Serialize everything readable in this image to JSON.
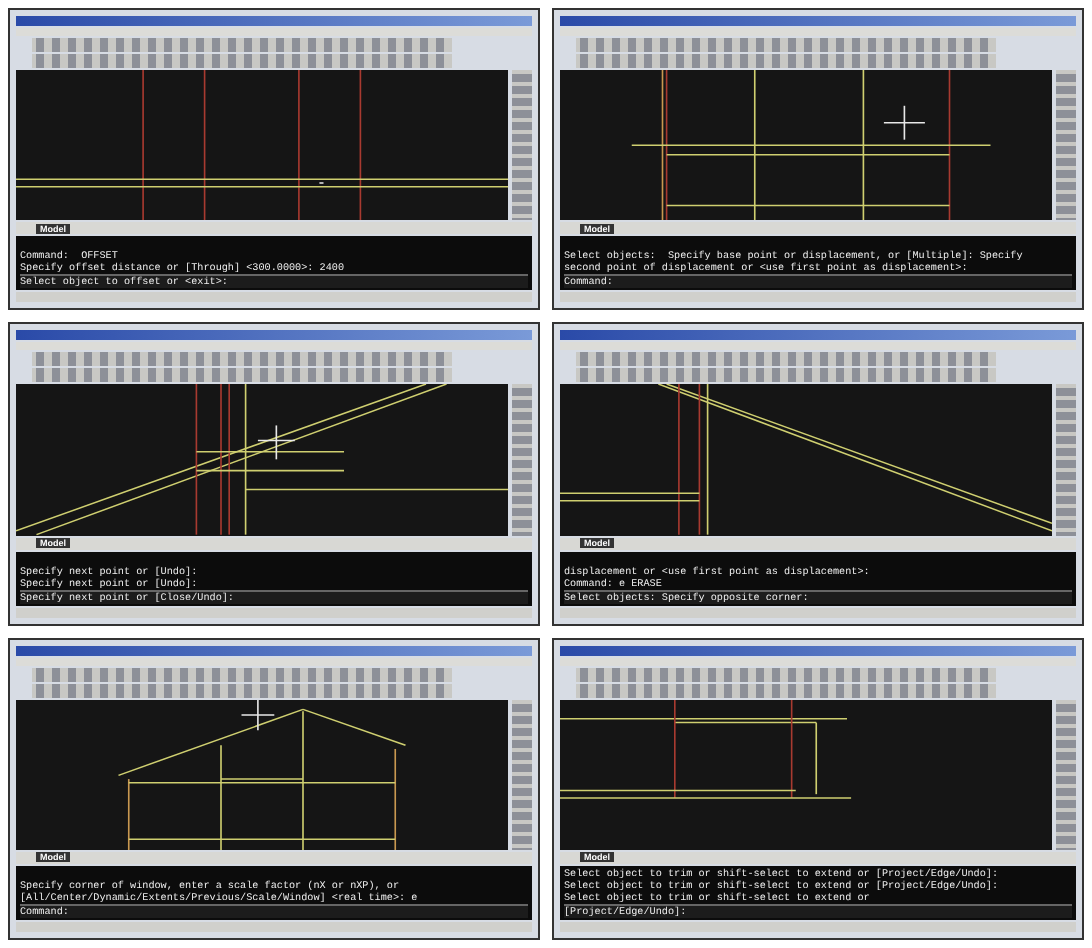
{
  "panels": [
    {
      "tab": {
        "label": "Model",
        "selected": true
      },
      "history": [
        "Command:  OFFSET",
        "Specify offset distance or [Through] <300.0000>: 2400"
      ],
      "prompt": "Select object to offset or <exit>:"
    },
    {
      "tab": {
        "label": "Model",
        "selected": true
      },
      "history": [
        "Select objects:  Specify base point or displacement, or [Multiple]: Specify",
        "second point of displacement or <use first point as displacement>:"
      ],
      "prompt": "Command:"
    },
    {
      "tab": {
        "label": "Model",
        "selected": true
      },
      "history": [
        "Specify next point or [Undo]:",
        "Specify next point or [Undo]:"
      ],
      "prompt": "Specify next point or [Close/Undo]:"
    },
    {
      "tab": {
        "label": "Model",
        "selected": true
      },
      "history": [
        "displacement or <use first point as displacement>:",
        "Command: e ERASE"
      ],
      "prompt": "Select objects: Specify opposite corner:"
    },
    {
      "tab": {
        "label": "Model",
        "selected": true
      },
      "history": [
        "Specify corner of window, enter a scale factor (nX or nXP), or",
        "[All/Center/Dynamic/Extents/Previous/Scale/Window] <real time>: e"
      ],
      "prompt": "Command:"
    },
    {
      "tab": {
        "label": "Model",
        "selected": true
      },
      "history": [
        "Select object to trim or shift-select to extend or [Project/Edge/Undo]:",
        "Select object to trim or shift-select to extend or [Project/Edge/Undo]:",
        "Select object to trim or shift-select to extend or"
      ],
      "prompt": "[Project/Edge/Undo]:"
    }
  ]
}
